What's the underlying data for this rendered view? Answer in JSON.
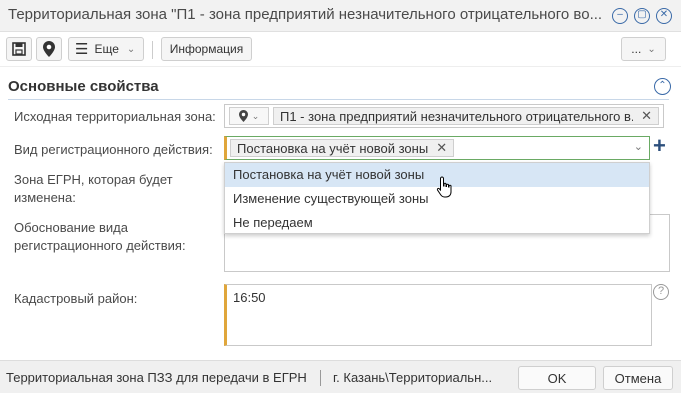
{
  "window": {
    "title": "Территориальная зона \"П1 - зона предприятий незначительного отрицательного во..."
  },
  "toolbar": {
    "more_label": "Еще",
    "info_label": "Информация",
    "overflow_label": "..."
  },
  "section": {
    "title": "Основные свойства"
  },
  "form": {
    "source_zone_label": "Исходная территориальная зона:",
    "source_zone_value": "П1 - зона предприятий незначительного отрицательного в...",
    "reg_action_label": "Вид регистрационного действия:",
    "reg_action_value": "Постановка на учёт новой зоны",
    "egrn_zone_label_line1": "Зона ЕГРН, которая будет",
    "egrn_zone_label_line2": "изменена:",
    "basis_label_line1": "Обоснование вида",
    "basis_label_line2": "регистрационного действия:",
    "cadastral_label": "Кадастровый район:",
    "cadastral_value": "16:50"
  },
  "dropdown": {
    "options": [
      "Постановка на учёт новой зоны",
      "Изменение существующей зоны",
      "Не передаем"
    ]
  },
  "statusbar": {
    "left_text": "Территориальная зона ПЗЗ для передачи в ЕГРН",
    "path_text": "г. Казань\\Территориальн...",
    "ok_label": "OK",
    "cancel_label": "Отмена"
  },
  "colors": {
    "accent": "#3a6aa8",
    "required_marker": "#e0a63b",
    "hover": "#d7e6f5"
  }
}
